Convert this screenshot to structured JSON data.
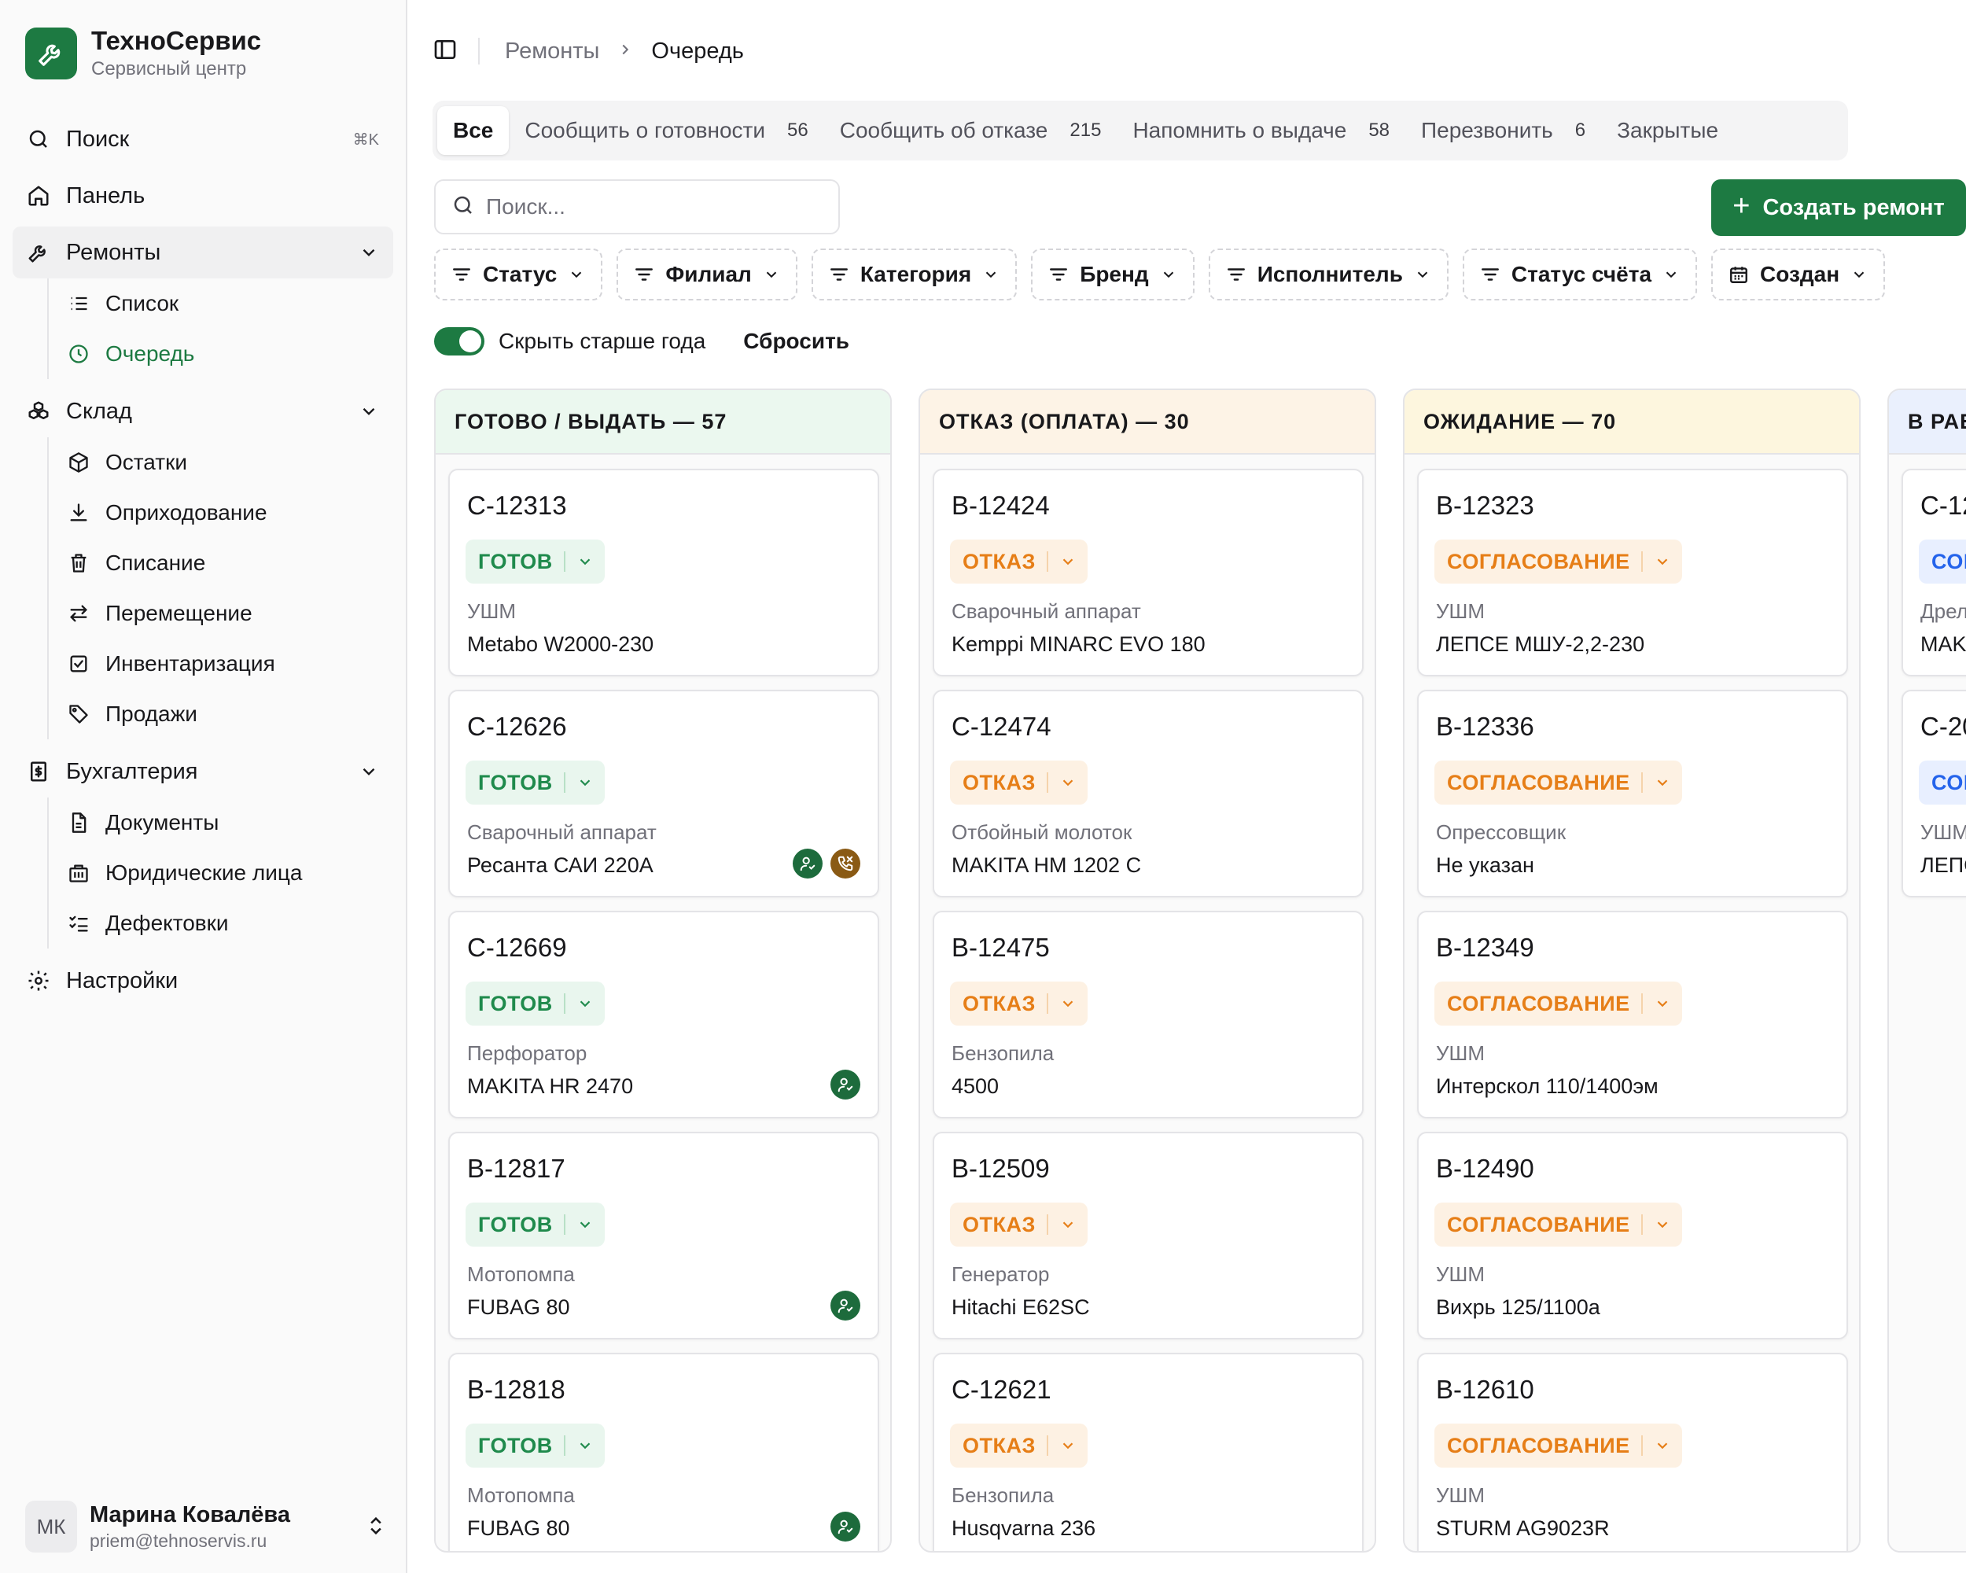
{
  "brand": {
    "name": "ТехноСервис",
    "subtitle": "Сервисный центр",
    "logo_icon": "wrench-icon"
  },
  "sidebar": {
    "search": {
      "label": "Поиск",
      "shortcut": "⌘K"
    },
    "dashboard": {
      "label": "Панель"
    },
    "repairs": {
      "label": "Ремонты",
      "items": [
        {
          "label": "Список"
        },
        {
          "label": "Очередь"
        }
      ]
    },
    "warehouse": {
      "label": "Склад",
      "items": [
        {
          "label": "Остатки"
        },
        {
          "label": "Оприходование"
        },
        {
          "label": "Списание"
        },
        {
          "label": "Перемещение"
        },
        {
          "label": "Инвентаризация"
        },
        {
          "label": "Продажи"
        }
      ]
    },
    "accounting": {
      "label": "Бухгалтерия",
      "items": [
        {
          "label": "Документы"
        },
        {
          "label": "Юридические лица"
        },
        {
          "label": "Дефектовки"
        }
      ]
    },
    "settings": {
      "label": "Настройки"
    }
  },
  "user": {
    "initials": "МК",
    "name": "Марина Ковалёва",
    "email": "priem@tehnoservis.ru"
  },
  "breadcrumb": {
    "parent": "Ремонты",
    "current": "Очередь"
  },
  "tabs": [
    {
      "label": "Все",
      "count": ""
    },
    {
      "label": "Сообщить о готовности",
      "count": "56"
    },
    {
      "label": "Сообщить об отказе",
      "count": "215"
    },
    {
      "label": "Напомнить о выдаче",
      "count": "58"
    },
    {
      "label": "Перезвонить",
      "count": "6"
    },
    {
      "label": "Закрытые",
      "count": ""
    }
  ],
  "search": {
    "placeholder": "Поиск...",
    "value": ""
  },
  "create_button": {
    "label": "Создать ремонт"
  },
  "filters": [
    {
      "label": "Статус",
      "icon": "filter-icon"
    },
    {
      "label": "Филиал",
      "icon": "filter-icon"
    },
    {
      "label": "Категория",
      "icon": "filter-icon"
    },
    {
      "label": "Бренд",
      "icon": "filter-icon"
    },
    {
      "label": "Исполнитель",
      "icon": "filter-icon"
    },
    {
      "label": "Статус счёта",
      "icon": "filter-icon"
    },
    {
      "label": "Создан",
      "icon": "calendar-icon"
    }
  ],
  "hide_old": {
    "label": "Скрыть старше года",
    "enabled": true
  },
  "reset_label": "Сбросить",
  "colors": {
    "accent": "#1d7a42",
    "ready": "#1f8a4c",
    "refusal": "#e67e17",
    "in_work": "#2463eb"
  },
  "columns": [
    {
      "title": "ГОТОВО / ВЫДАТЬ — 57",
      "header_bg": "#ebf8ef",
      "badge_style": "green",
      "cards": [
        {
          "id": "С-12313",
          "status": "ГОТОВ",
          "category": "УШМ",
          "model": "Metabo W2000-230",
          "marks": []
        },
        {
          "id": "С-12626",
          "status": "ГОТОВ",
          "category": "Сварочный аппарат",
          "model": "Ресанта САИ 220А",
          "marks": [
            "user-icon",
            "phone-icon"
          ]
        },
        {
          "id": "С-12669",
          "status": "ГОТОВ",
          "category": "Перфоратор",
          "model": "MAKITA HR 2470",
          "marks": [
            "user-icon"
          ]
        },
        {
          "id": "В-12817",
          "status": "ГОТОВ",
          "category": "Мотопомпа",
          "model": "FUBAG 80",
          "marks": [
            "user-icon"
          ]
        },
        {
          "id": "В-12818",
          "status": "ГОТОВ",
          "category": "Мотопомпа",
          "model": "FUBAG 80",
          "marks": [
            "user-icon"
          ]
        }
      ]
    },
    {
      "title": "ОТКАЗ (ОПЛАТА) — 30",
      "header_bg": "#fdf3e6",
      "badge_style": "orange",
      "cards": [
        {
          "id": "В-12424",
          "status": "ОТКАЗ",
          "category": "Сварочный аппарат",
          "model": "Kemppi MINARC EVO 180",
          "marks": []
        },
        {
          "id": "С-12474",
          "status": "ОТКАЗ",
          "category": "Отбойный молоток",
          "model": "MAKITA HM 1202 C",
          "marks": []
        },
        {
          "id": "В-12475",
          "status": "ОТКАЗ",
          "category": "Бензопила",
          "model": "4500",
          "marks": []
        },
        {
          "id": "В-12509",
          "status": "ОТКАЗ",
          "category": "Генератор",
          "model": "Hitachi E62SC",
          "marks": []
        },
        {
          "id": "С-12621",
          "status": "ОТКАЗ",
          "category": "Бензопила",
          "model": "Husqvarna 236",
          "marks": []
        }
      ]
    },
    {
      "title": "ОЖИДАНИЕ — 70",
      "header_bg": "#fdf6de",
      "badge_style": "orange",
      "cards": [
        {
          "id": "В-12323",
          "status": "СОГЛАСОВАНИЕ",
          "category": "УШМ",
          "model": "ЛЕПСЕ МШУ-2,2-230",
          "marks": []
        },
        {
          "id": "В-12336",
          "status": "СОГЛАСОВАНИЕ",
          "category": "Опрессовщик",
          "model": "Не указан",
          "marks": []
        },
        {
          "id": "В-12349",
          "status": "СОГЛАСОВАНИЕ",
          "category": "УШМ",
          "model": "Интерскол 110/1400эм",
          "marks": []
        },
        {
          "id": "В-12490",
          "status": "СОГЛАСОВАНИЕ",
          "category": "УШМ",
          "model": "Вихрь 125/1100а",
          "marks": []
        },
        {
          "id": "В-12610",
          "status": "СОГЛАСОВАНИЕ",
          "category": "УШМ",
          "model": "STURM AG9023R",
          "marks": []
        }
      ]
    },
    {
      "title": "В РАБ",
      "header_bg": "#eaf0fd",
      "badge_style": "blue",
      "cards": [
        {
          "id": "С-12",
          "status": "СОГ",
          "category": "Дрел",
          "model": "MAKI",
          "marks": []
        },
        {
          "id": "С-20",
          "status": "СОГ",
          "category": "УШМ",
          "model": "ЛЕПС",
          "marks": []
        }
      ]
    }
  ]
}
